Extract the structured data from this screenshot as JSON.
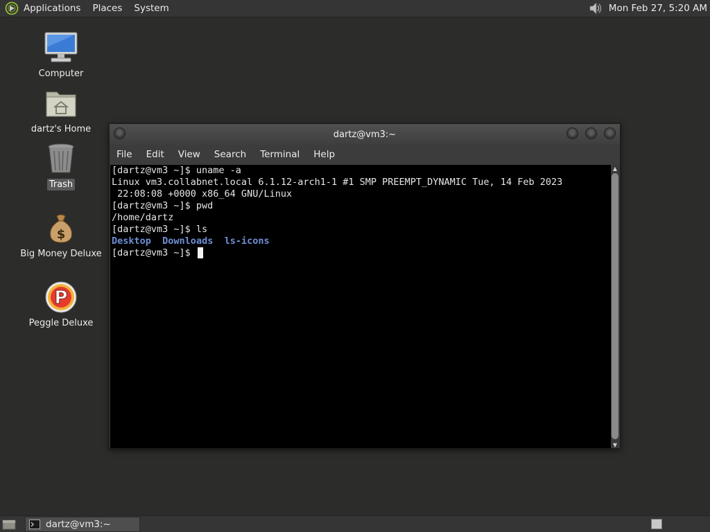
{
  "top_panel": {
    "menus": [
      "Applications",
      "Places",
      "System"
    ],
    "clock": "Mon Feb 27,  5:20 AM"
  },
  "desktop_icons": [
    {
      "label": "Computer",
      "icon": "computer-icon"
    },
    {
      "label": "dartz's Home",
      "icon": "home-folder-icon"
    },
    {
      "label": "Trash",
      "icon": "trash-icon"
    },
    {
      "label": "Big Money Deluxe",
      "icon": "money-bag-icon"
    },
    {
      "label": "Peggle Deluxe",
      "icon": "peggle-icon"
    }
  ],
  "terminal": {
    "title": "dartz@vm3:~",
    "menu": [
      "File",
      "Edit",
      "View",
      "Search",
      "Terminal",
      "Help"
    ],
    "lines": [
      "[dartz@vm3 ~]$ uname -a",
      "Linux vm3.collabnet.local 6.1.12-arch1-1 #1 SMP PREEMPT_DYNAMIC Tue, 14 Feb 2023",
      " 22:08:08 +0000 x86_64 GNU/Linux",
      "[dartz@vm3 ~]$ pwd",
      "/home/dartz",
      "[dartz@vm3 ~]$ ls"
    ],
    "ls_output": [
      "Desktop",
      "Downloads",
      "ls-icons"
    ],
    "prompt": "[dartz@vm3 ~]$ "
  },
  "bottom_panel": {
    "task_label": "dartz@vm3:~"
  },
  "colors": {
    "desktop_bg": "#2c2d2a",
    "panel_bg": "#353535",
    "terminal_bg": "#000000",
    "dir_color": "#6f8fd6"
  }
}
